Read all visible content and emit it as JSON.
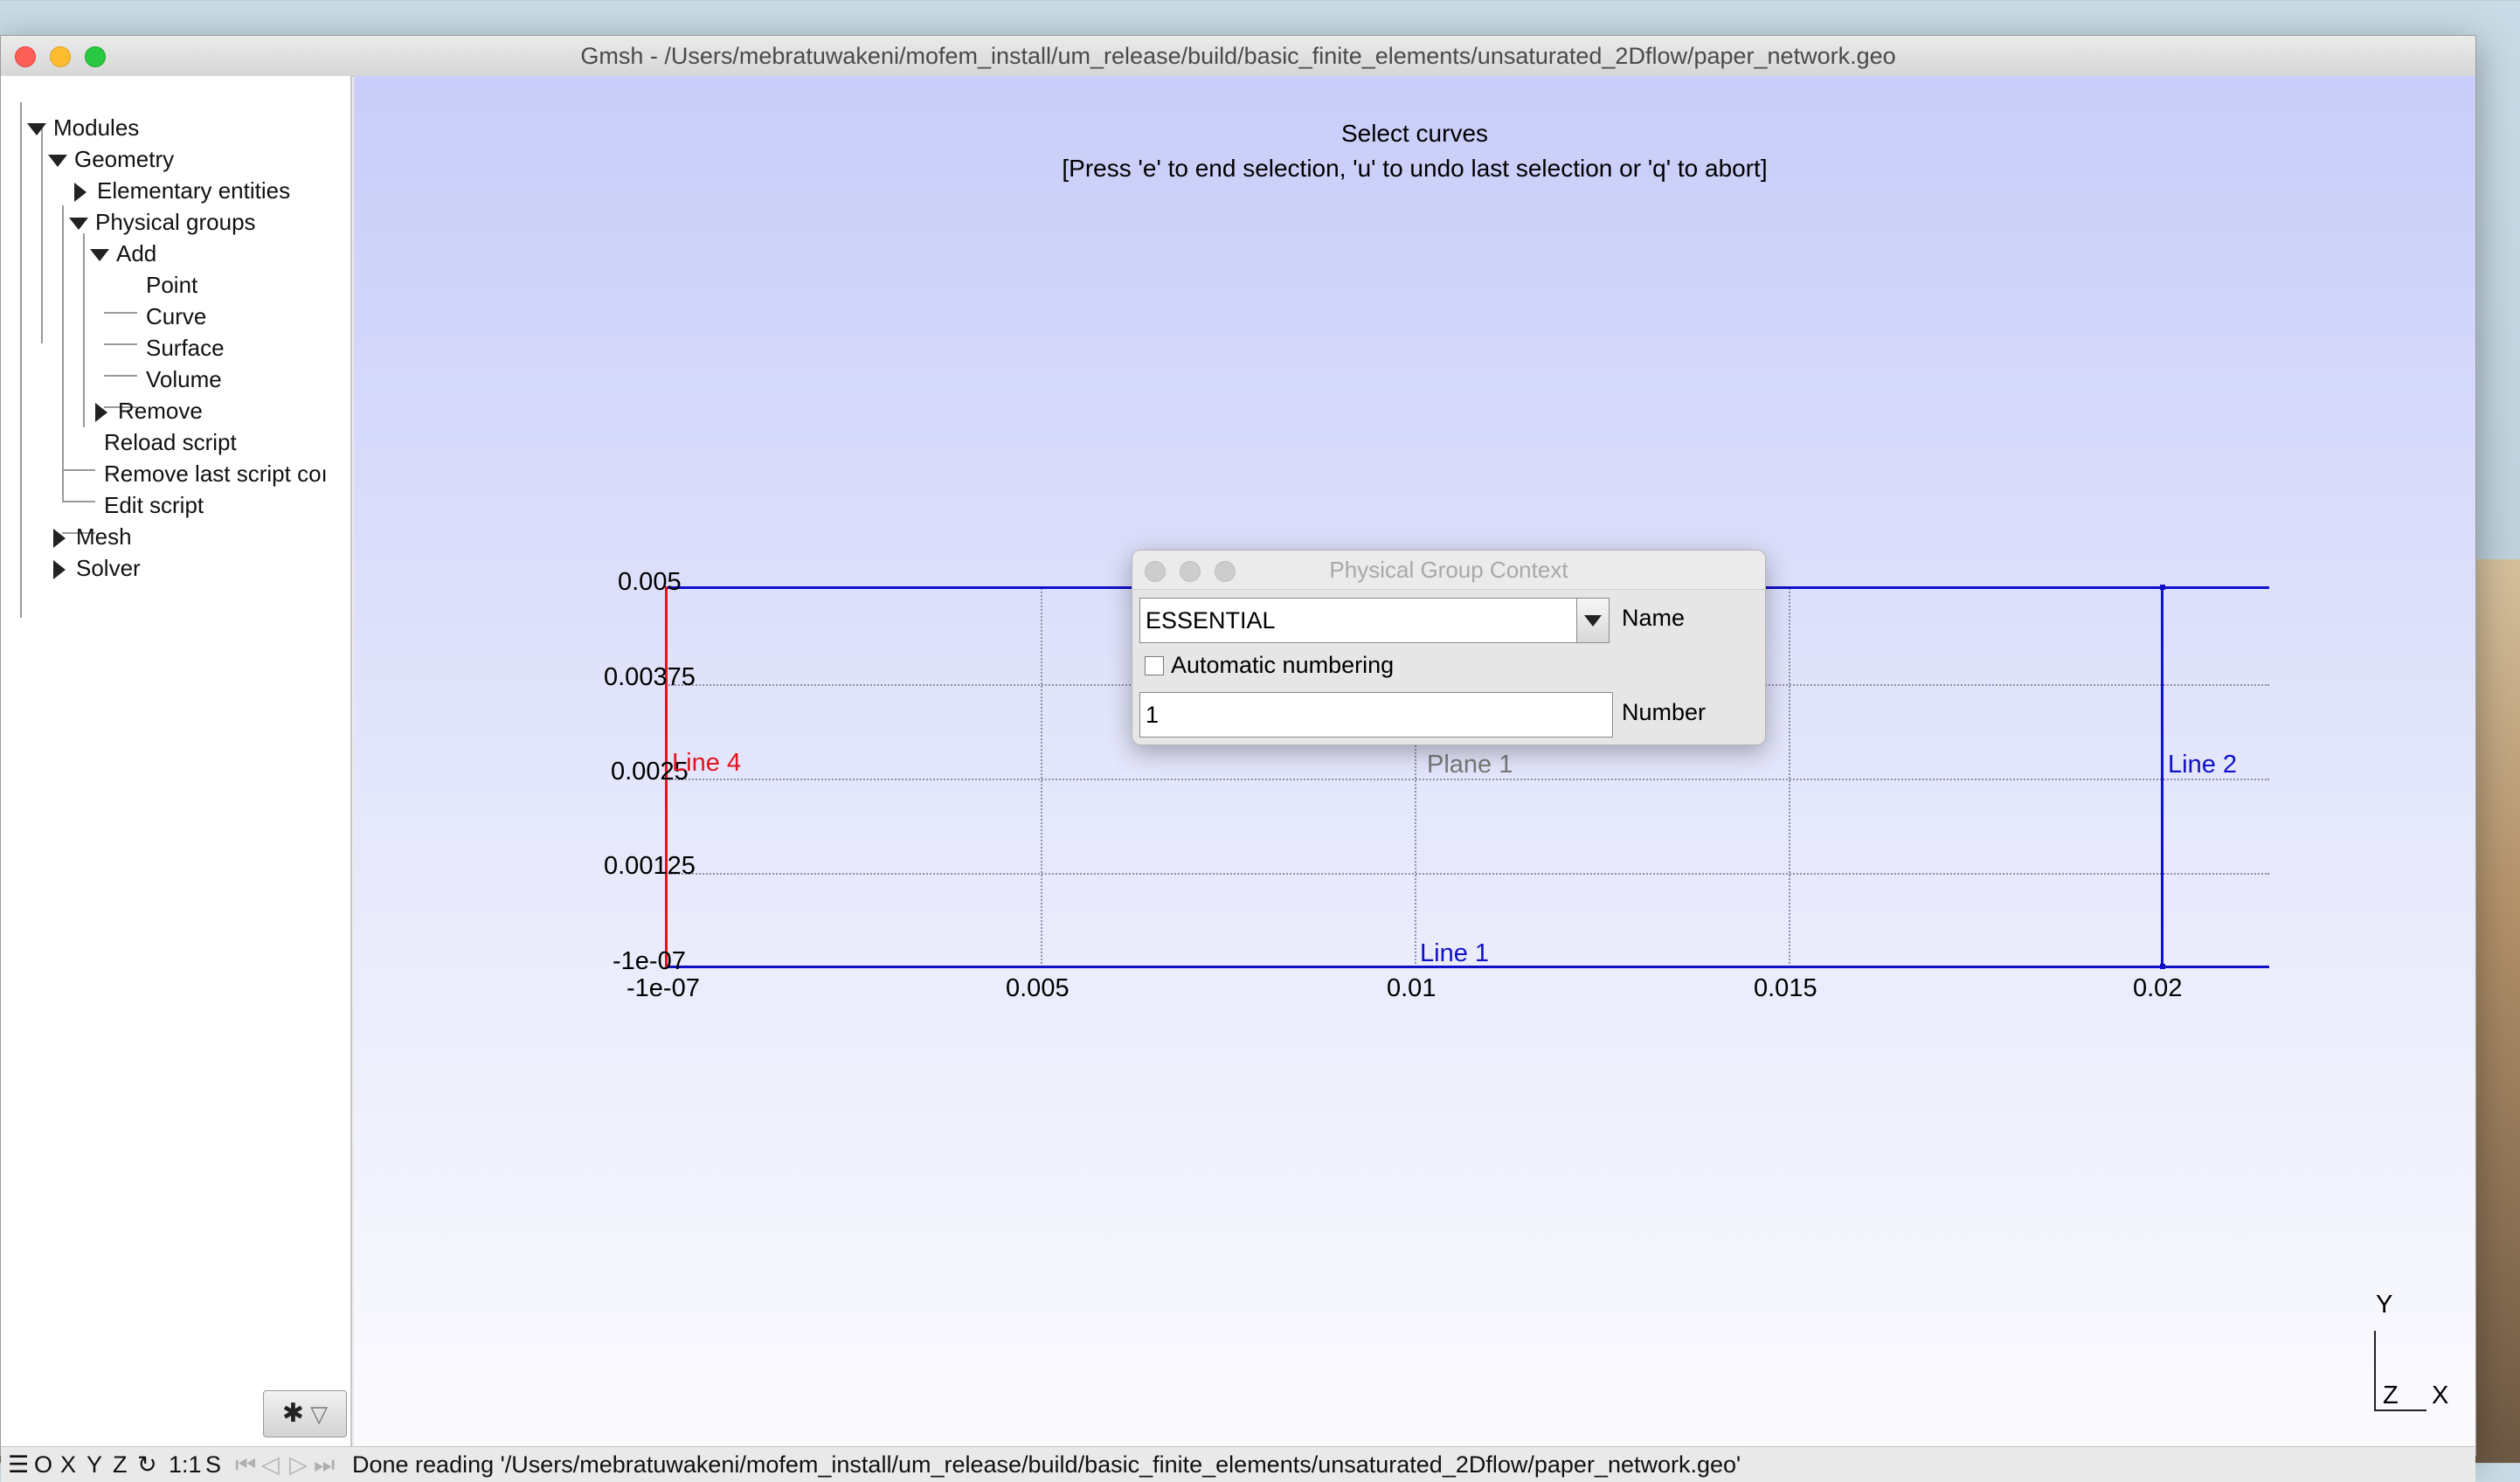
{
  "window": {
    "title": "Gmsh - /Users/mebratuwakeni/mofem_install/um_release/build/basic_finite_elements/unsaturated_2Dflow/paper_network.geo"
  },
  "tree": {
    "modules": "Modules",
    "geometry": "Geometry",
    "elementary": "Elementary entities",
    "physical": "Physical groups",
    "add": "Add",
    "point": "Point",
    "curve": "Curve",
    "surface": "Surface",
    "volume": "Volume",
    "remove": "Remove",
    "reload": "Reload script",
    "remove_last": "Remove last script coı",
    "edit": "Edit script",
    "mesh": "Mesh",
    "solver": "Solver"
  },
  "viewport": {
    "heading": "Select curves",
    "instructions": "[Press 'e' to end selection, 'u' to undo last selection or 'q' to abort]",
    "y_ticks": [
      "0.005",
      "0.00375",
      "0.0025",
      "0.00125",
      "-1e-07"
    ],
    "x_ticks": [
      "-1e-07",
      "0.005",
      "0.01",
      "0.015",
      "0.02"
    ],
    "labels": {
      "line4": "Line 4",
      "line2": "Line 2",
      "line1": "Line 1",
      "plane1": "Plane 1"
    },
    "colors": {
      "line4": "#e0141e",
      "blue_lines": "#1010c8",
      "plane": "#7a7a7a"
    },
    "axes": {
      "y": "Y",
      "z": "Z",
      "x": "X"
    }
  },
  "dialog": {
    "title": "Physical Group Context",
    "name_value": "ESSENTIAL",
    "name_label": "Name",
    "auto_numbering_label": "Automatic numbering",
    "auto_numbering_checked": false,
    "number_value": "1",
    "number_label": "Number"
  },
  "statusbar": {
    "menu_icon": "menu-icon",
    "o": "O",
    "x": "X",
    "y": "Y",
    "z": "Z",
    "rotate_icon": "rotate-icon",
    "scale": "1:1",
    "s": "S",
    "message": "Done reading '/Users/mebratuwakeni/mofem_install/um_release/build/basic_finite_elements/unsaturated_2Dflow/paper_network.geo'"
  }
}
